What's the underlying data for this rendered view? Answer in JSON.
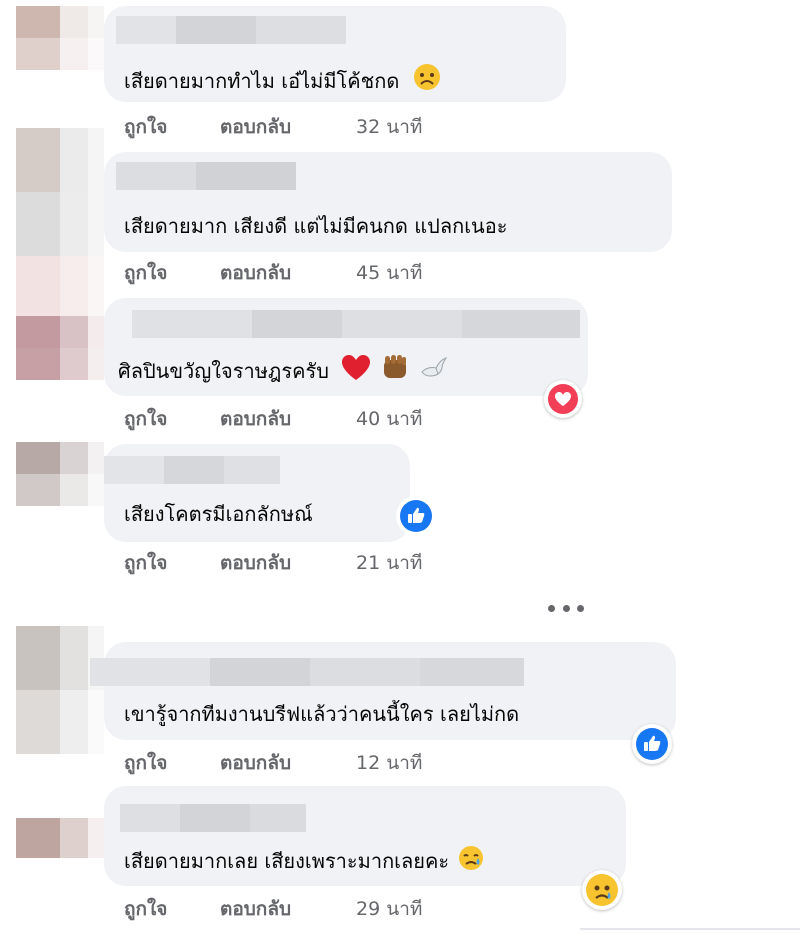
{
  "comments": [
    {
      "text": "เสียดายมากทำไม เอ๋ไม่มีโค้ชกด",
      "like": "ถูกใจ",
      "reply": "ตอบกลับ",
      "time": "32 นาที",
      "emoji": "sad-face"
    },
    {
      "text": "เสียดายมาก เสียงดี แต่ไม่มีคนกด แปลกเนอะ",
      "like": "ถูกใจ",
      "reply": "ตอบกลับ",
      "time": "45 นาที"
    },
    {
      "text": "ศิลปินขวัญใจราษฎรครับ",
      "like": "ถูกใจ",
      "reply": "ตอบกลับ",
      "time": "40 นาที",
      "emoji": "heart, raised-fist, dove",
      "reaction": "love"
    },
    {
      "text": "เสียงโคตรมีเอกลักษณ์",
      "like": "ถูกใจ",
      "reply": "ตอบกลับ",
      "time": "21 นาที",
      "reaction": "like"
    },
    {
      "text": "เขารู้จากทีมงานบรีฟแล้วว่าคนนี้ใคร เลยไม่กด",
      "like": "ถูกใจ",
      "reply": "ตอบกลับ",
      "time": "12 นาที",
      "reaction": "like"
    },
    {
      "text": "เสียดายมากเลย เสียงเพราะมากเลยคะ",
      "like": "ถูกใจ",
      "reply": "ตอบกลับ",
      "time": "29 นาที",
      "emoji": "sad-tear-face",
      "reaction": "sad"
    }
  ],
  "colors": {
    "bubble": "#f0f2f5",
    "meta": "#65676b",
    "like_blue": "#1877f2",
    "love_red": "#f33e58"
  }
}
